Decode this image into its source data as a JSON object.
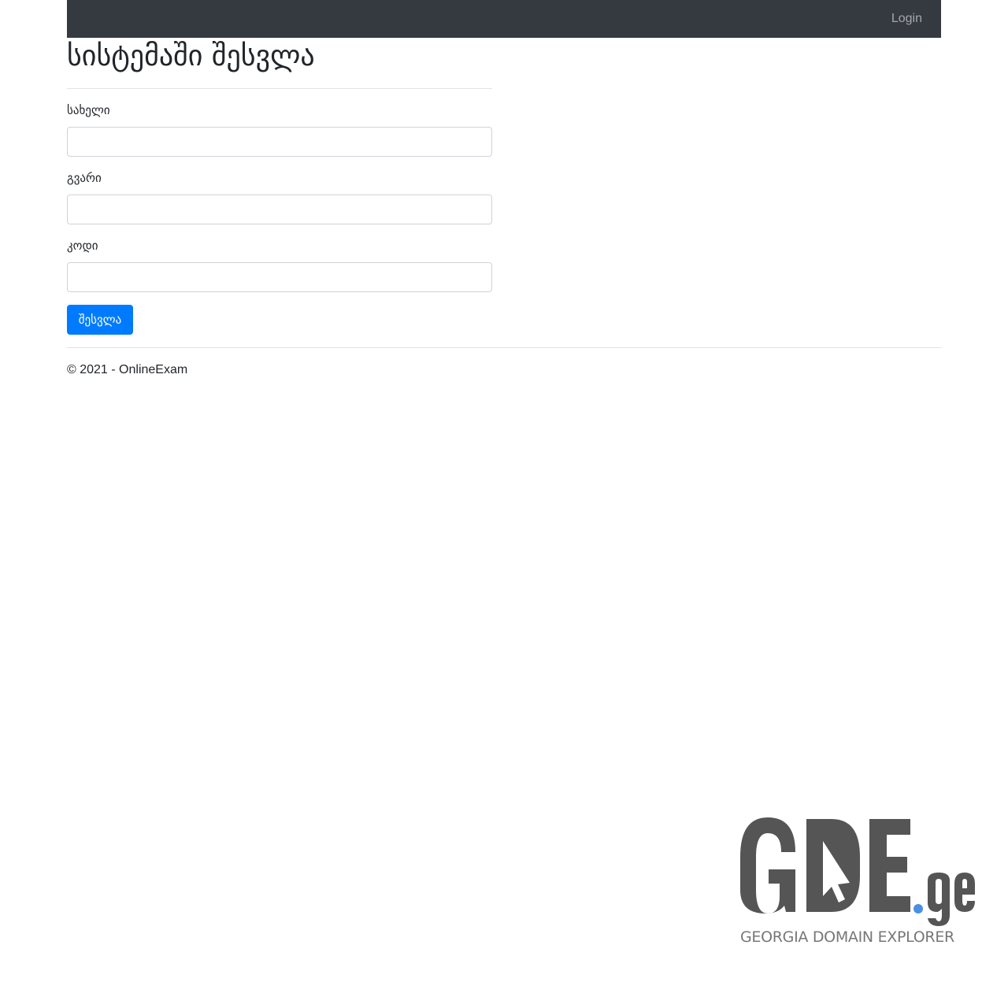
{
  "navbar": {
    "login_label": "Login"
  },
  "page": {
    "title": "სისტემაში შესვლა"
  },
  "form": {
    "first_name": {
      "label": "სახელი",
      "value": "",
      "placeholder": ""
    },
    "last_name": {
      "label": "გვარი",
      "value": "",
      "placeholder": ""
    },
    "code": {
      "label": "კოდი",
      "value": "",
      "placeholder": ""
    },
    "submit_label": "შესვლა"
  },
  "footer": {
    "copyright": "© 2021 - OnlineExam"
  },
  "watermark": {
    "logo_text": "GDE",
    "logo_suffix": ".ge",
    "tagline": "GEORGIA DOMAIN EXPLORER"
  },
  "colors": {
    "navbar_bg": "#343a40",
    "primary": "#007bff",
    "watermark_gray": "#555555",
    "watermark_dot": "#4a90e2"
  }
}
